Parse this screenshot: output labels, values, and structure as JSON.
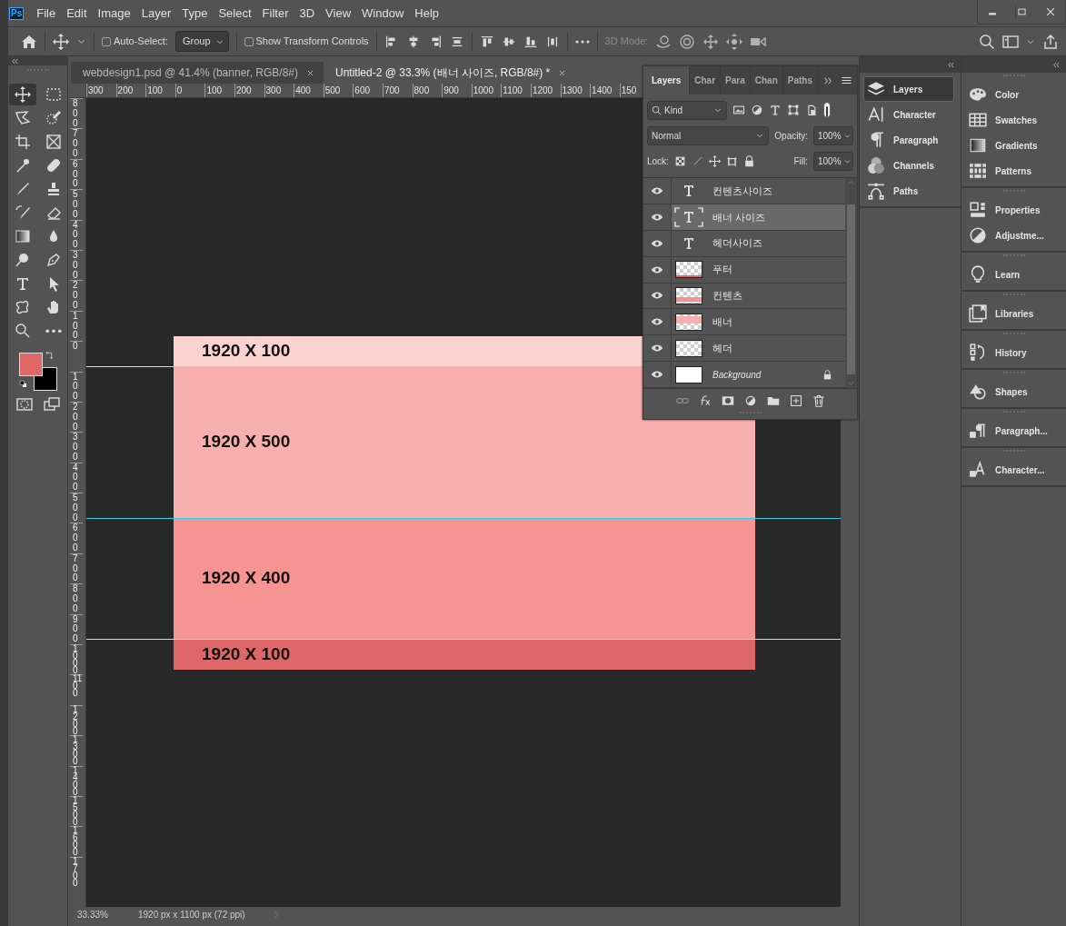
{
  "app_logo": "Ps",
  "menu_bar": {
    "items": [
      "File",
      "Edit",
      "Image",
      "Layer",
      "Type",
      "Select",
      "Filter",
      "3D",
      "View",
      "Window",
      "Help"
    ]
  },
  "options_bar": {
    "auto_select": {
      "label": "Auto-Select:",
      "checked": false
    },
    "target": {
      "value": "Group"
    },
    "transform_controls": {
      "label": "Show Transform Controls",
      "checked": false
    },
    "mode_3d": {
      "label": "3D Mode:",
      "disabled": true
    }
  },
  "toolbar": {
    "tools": [
      {
        "kind": "move",
        "selected": true
      },
      {
        "kind": "marquee",
        "selected": false
      },
      {
        "kind": "lasso",
        "selected": false
      },
      {
        "kind": "quickselect",
        "selected": false
      },
      {
        "kind": "crop",
        "selected": false
      },
      {
        "kind": "frame",
        "selected": false
      },
      {
        "kind": "eyedropper",
        "selected": false
      },
      {
        "kind": "healing",
        "selected": false
      },
      {
        "kind": "brush",
        "selected": false
      },
      {
        "kind": "stamp",
        "selected": false
      },
      {
        "kind": "historybrush",
        "selected": false
      },
      {
        "kind": "eraser",
        "selected": false
      },
      {
        "kind": "gradient",
        "selected": false
      },
      {
        "kind": "blur",
        "selected": false
      },
      {
        "kind": "dodge",
        "selected": false
      },
      {
        "kind": "pen",
        "selected": false
      },
      {
        "kind": "type",
        "selected": false
      },
      {
        "kind": "pathselect",
        "selected": false
      },
      {
        "kind": "shape",
        "selected": false
      },
      {
        "kind": "hand",
        "selected": false
      },
      {
        "kind": "zoom",
        "selected": false
      },
      {
        "kind": "more",
        "selected": false
      }
    ],
    "colors": [
      {
        "color": "#df6767"
      },
      {
        "color": "#000000"
      }
    ]
  },
  "document_tabs": [
    {
      "title": "webdesign1.psd @ 41.4% (banner, RGB/8#)",
      "selected": false
    },
    {
      "title": "Untitled-2 @ 33.3% (배너 사이즈, RGB/8#) *",
      "selected": true
    }
  ],
  "rulers": {
    "horizontal": [
      "300",
      "200",
      "100",
      "0",
      "100",
      "200",
      "300",
      "400",
      "500",
      "600",
      "700",
      "800",
      "900",
      "1000",
      "1100",
      "1200",
      "1300",
      "1400",
      "150"
    ],
    "vertical": [
      "800",
      "700",
      "600",
      "500",
      "400",
      "300",
      "200",
      "100",
      "0",
      "100",
      "200",
      "300",
      "400",
      "500",
      "600",
      "700",
      "800",
      "900",
      "1000",
      "1100",
      "1200",
      "1300",
      "1400",
      "1500",
      "1600",
      "1700"
    ]
  },
  "canvas": {
    "bands": [
      {
        "label": "1920 X 100",
        "color": "#fdd3d2"
      },
      {
        "label": "1920 X 500",
        "color": "#f8b0ae"
      },
      {
        "label": "1920 X 400",
        "color": "#f59491"
      },
      {
        "label": "1920 X 100",
        "color": "#de6868"
      }
    ]
  },
  "status_bar": {
    "zoom": "33.33%",
    "document_size": "1920 px x 1100 px (72 ppi)"
  },
  "layers_panel": {
    "tabs": [
      {
        "label": "Layers",
        "selected": true
      },
      {
        "label": "Char",
        "selected": false
      },
      {
        "label": "Para",
        "selected": false
      },
      {
        "label": "Chan",
        "selected": false
      },
      {
        "label": "Paths",
        "selected": false
      }
    ],
    "filter": {
      "value": "Kind"
    },
    "blend_mode": {
      "value": "Normal"
    },
    "opacity": {
      "label": "Opacity:",
      "value": "100%"
    },
    "lock": {
      "label": "Lock:"
    },
    "fill": {
      "label": "Fill:",
      "value": "100%"
    },
    "layers": [
      {
        "kind": "text",
        "name": "컨텐츠사이즈",
        "visible": true,
        "selected": false
      },
      {
        "kind": "text",
        "name": "배너 사이즈",
        "visible": true,
        "selected": true
      },
      {
        "kind": "text",
        "name": "헤더사이즈",
        "visible": true,
        "selected": false
      },
      {
        "kind": "pixel",
        "name": "푸터",
        "visible": true,
        "selected": false
      },
      {
        "kind": "pixel",
        "name": "컨텐츠",
        "visible": true,
        "selected": false
      },
      {
        "kind": "pixel",
        "name": "배너",
        "visible": true,
        "selected": false
      },
      {
        "kind": "pixel",
        "name": "헤더",
        "visible": true,
        "selected": false
      },
      {
        "kind": "background",
        "name": "Background",
        "locked": true,
        "visible": true,
        "selected": false
      }
    ]
  },
  "panel_dock": {
    "column_1": [
      {
        "kind": "layers",
        "label": "Layers",
        "selected": true
      },
      {
        "kind": "character",
        "label": "Character",
        "selected": false
      },
      {
        "kind": "paragraph",
        "label": "Paragraph",
        "selected": false
      },
      {
        "kind": "channels",
        "label": "Channels",
        "selected": false
      },
      {
        "kind": "paths",
        "label": "Paths",
        "selected": false
      }
    ],
    "column_2": [
      {
        "items": [
          {
            "kind": "color",
            "label": "Color"
          },
          {
            "kind": "swatches",
            "label": "Swatches"
          },
          {
            "kind": "gradients",
            "label": "Gradients"
          },
          {
            "kind": "patterns",
            "label": "Patterns"
          }
        ]
      },
      {
        "items": [
          {
            "kind": "properties",
            "label": "Properties"
          },
          {
            "kind": "adjustments",
            "label": "Adjustme..."
          }
        ]
      },
      {
        "items": [
          {
            "kind": "learn",
            "label": "Learn"
          }
        ]
      },
      {
        "items": [
          {
            "kind": "libraries",
            "label": "Libraries"
          }
        ]
      },
      {
        "items": [
          {
            "kind": "history",
            "label": "History"
          }
        ]
      },
      {
        "items": [
          {
            "kind": "shapes",
            "label": "Shapes"
          }
        ]
      },
      {
        "items": [
          {
            "kind": "paragraph-styles",
            "label": "Paragraph..."
          }
        ]
      },
      {
        "items": [
          {
            "kind": "character-styles",
            "label": "Character..."
          }
        ]
      }
    ]
  }
}
